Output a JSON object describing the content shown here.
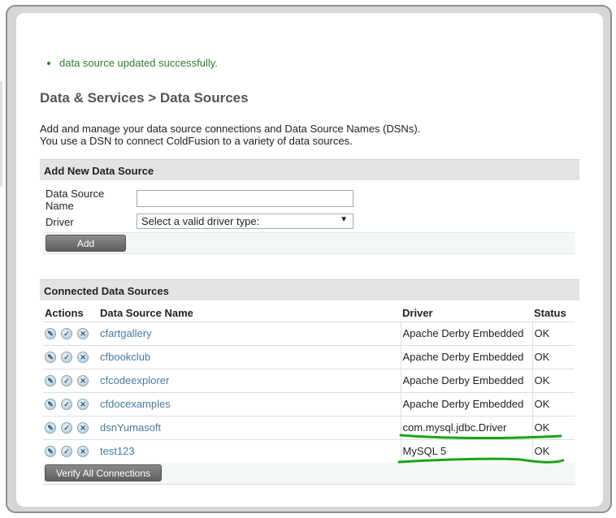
{
  "message": {
    "text": "data source updated successfully."
  },
  "page": {
    "title": "Data & Services > Data Sources"
  },
  "intro": {
    "line1": "Add and manage your data source connections and Data Source Names (DSNs).",
    "line2": "You use a DSN to connect ColdFusion to a variety of data sources."
  },
  "add_section": {
    "header": "Add New Data Source",
    "name_label_1": "Data Source",
    "name_label_2": "Name",
    "name_value": "",
    "driver_label": "Driver",
    "driver_select": "Select a valid driver type:",
    "add_button": "Add"
  },
  "connected": {
    "header": "Connected Data Sources",
    "columns": {
      "actions": "Actions",
      "name": "Data Source Name",
      "driver": "Driver",
      "status": "Status"
    },
    "rows": [
      {
        "name": "cfartgallery",
        "driver": "Apache Derby Embedded",
        "status": "OK"
      },
      {
        "name": "cfbookclub",
        "driver": "Apache Derby Embedded",
        "status": "OK"
      },
      {
        "name": "cfcodeexplorer",
        "driver": "Apache Derby Embedded",
        "status": "OK"
      },
      {
        "name": "cfdocexamples",
        "driver": "Apache Derby Embedded",
        "status": "OK"
      },
      {
        "name": "dsnYumasoft",
        "driver": "com.mysql.jdbc.Driver",
        "status": "OK"
      },
      {
        "name": "test123",
        "driver": "MySQL 5",
        "status": "OK"
      }
    ],
    "verify_button": "Verify All Connections"
  },
  "icons": {
    "edit": "pencil-icon",
    "verify": "check-icon",
    "delete": "x-icon"
  },
  "colors": {
    "success": "#2e7d32",
    "link": "#4a7aa0",
    "annotation": "#1aa31a"
  }
}
